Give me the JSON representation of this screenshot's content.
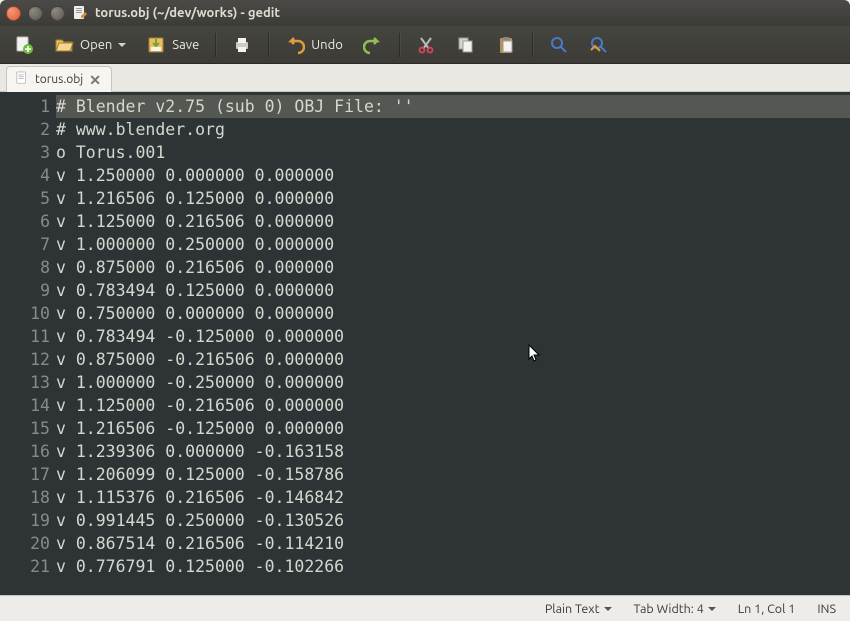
{
  "window": {
    "title": "torus.obj (~/dev/works) - gedit"
  },
  "toolbar": {
    "open_label": "Open",
    "save_label": "Save",
    "undo_label": "Undo"
  },
  "tab": {
    "label": "torus.obj"
  },
  "editor": {
    "lines": [
      "# Blender v2.75 (sub 0) OBJ File: ''",
      "# www.blender.org",
      "o Torus.001",
      "v 1.250000 0.000000 0.000000",
      "v 1.216506 0.125000 0.000000",
      "v 1.125000 0.216506 0.000000",
      "v 1.000000 0.250000 0.000000",
      "v 0.875000 0.216506 0.000000",
      "v 0.783494 0.125000 0.000000",
      "v 0.750000 0.000000 0.000000",
      "v 0.783494 -0.125000 0.000000",
      "v 0.875000 -0.216506 0.000000",
      "v 1.000000 -0.250000 0.000000",
      "v 1.125000 -0.216506 0.000000",
      "v 1.216506 -0.125000 0.000000",
      "v 1.239306 0.000000 -0.163158",
      "v 1.206099 0.125000 -0.158786",
      "v 1.115376 0.216506 -0.146842",
      "v 0.991445 0.250000 -0.130526",
      "v 0.867514 0.216506 -0.114210",
      "v 0.776791 0.125000 -0.102266"
    ]
  },
  "statusbar": {
    "lang": "Plain Text",
    "tabwidth": "Tab Width: 4",
    "pos": "Ln 1, Col 1",
    "ins": "INS"
  }
}
